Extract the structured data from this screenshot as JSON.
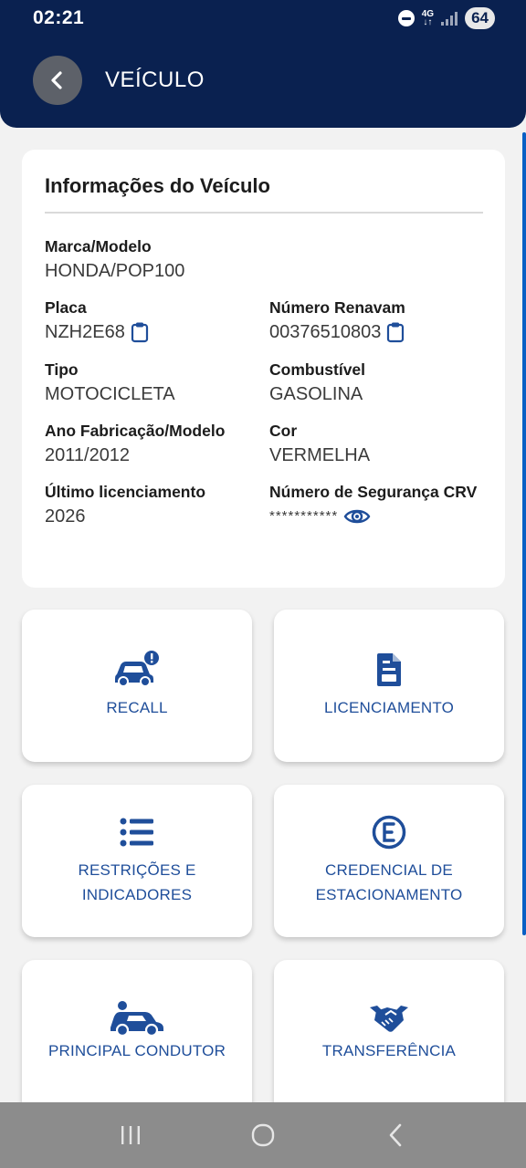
{
  "status_bar": {
    "time": "02:21",
    "network": "4G",
    "battery": "64"
  },
  "header": {
    "title": "VEÍCULO"
  },
  "info_card": {
    "title": "Informações do Veículo",
    "fields": {
      "marca_modelo": {
        "label": "Marca/Modelo",
        "value": "HONDA/POP100"
      },
      "placa": {
        "label": "Placa",
        "value": "NZH2E68"
      },
      "renavam": {
        "label": "Número Renavam",
        "value": "00376510803"
      },
      "tipo": {
        "label": "Tipo",
        "value": "MOTOCICLETA"
      },
      "combustivel": {
        "label": "Combustível",
        "value": "GASOLINA"
      },
      "ano": {
        "label": "Ano Fabricação/Modelo",
        "value": "2011/2012"
      },
      "cor": {
        "label": "Cor",
        "value": "VERMELHA"
      },
      "licenciamento": {
        "label": "Último licenciamento",
        "value": "2026"
      },
      "seguranca_crv": {
        "label": "Número de Segurança CRV",
        "value": "***********"
      }
    }
  },
  "tiles": {
    "recall": {
      "label": "RECALL",
      "icon": "car-alert-icon"
    },
    "licenciamento": {
      "label": "LICENCIAMENTO",
      "icon": "document-icon"
    },
    "restricoes": {
      "label_line1": "RESTRIÇÕES E",
      "label_line2": "INDICADORES",
      "icon": "list-icon"
    },
    "credencial": {
      "label_line1": "CREDENCIAL DE",
      "label_line2": "ESTACIONAMENTO",
      "icon": "e-circle-icon"
    },
    "condutor": {
      "label": "PRINCIPAL CONDUTOR",
      "icon": "car-user-icon"
    },
    "transferencia": {
      "label": "TRANSFERÊNCIA",
      "icon": "handshake-icon"
    }
  },
  "colors": {
    "header_bg": "#0a2150",
    "accent": "#1f4e9a",
    "page_bg": "#f2f2f2"
  }
}
